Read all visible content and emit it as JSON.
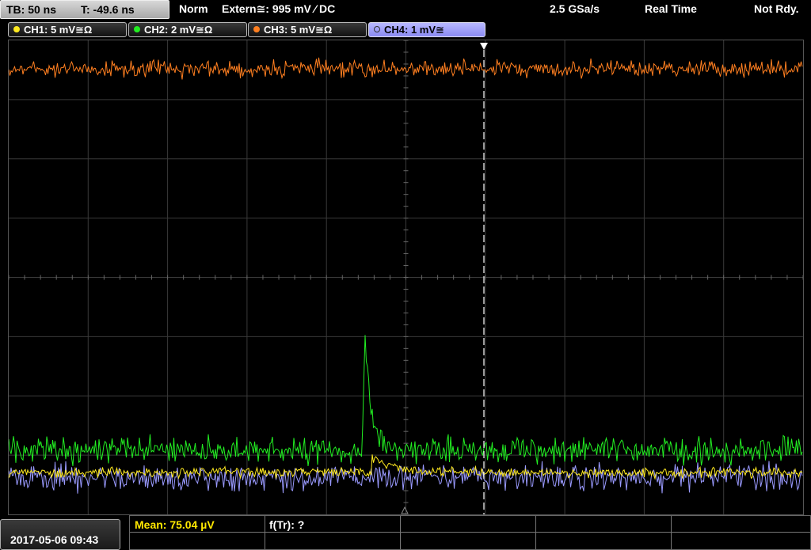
{
  "timebase": {
    "tb_label": "TB: 50 ns",
    "trigger_time_label": "T: -49.6 ns"
  },
  "status": {
    "mode": "Norm",
    "trigger_source": "Extern≅: 995 mV ⁄ DC",
    "sample_rate": "2.5 GSa/s",
    "acquisition": "Real Time",
    "state": "Not Rdy."
  },
  "channels": [
    {
      "label": "CH1: 5 mV≅Ω",
      "color": "#ffea20",
      "active": false
    },
    {
      "label": "CH2: 2 mV≅Ω",
      "color": "#22ee22",
      "active": false
    },
    {
      "label": "CH3: 5 mV≅Ω",
      "color": "#ff7f20",
      "active": false
    },
    {
      "label": "CH4: 1 mV≅",
      "color": "#9a9aff",
      "active": true
    }
  ],
  "footer": {
    "datetime": "2017-05-06 09:43",
    "measurement_mean": "Mean: 75.04 µV",
    "measurement_ftr": "f(Tr): ?"
  },
  "colors": {
    "ch1": "#ffea20",
    "ch2": "#22ee22",
    "ch3": "#ff7f20",
    "ch4": "#9a9aff",
    "grid": "#3a3a3a",
    "trigger_line": "#ffffff"
  }
}
